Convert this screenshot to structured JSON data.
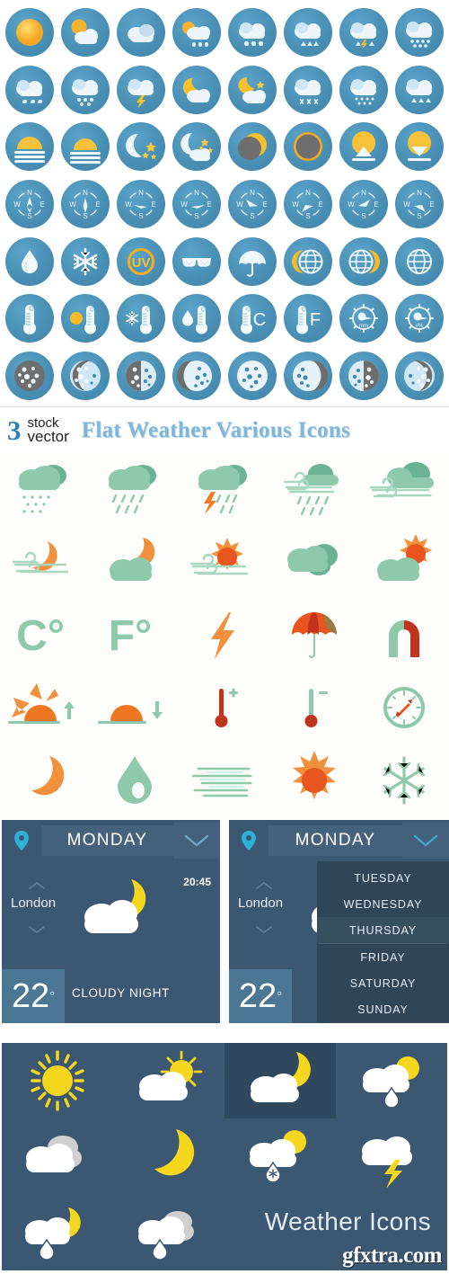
{
  "title_band": {
    "number": "3",
    "stock": "stock",
    "vector": "vector",
    "title": "Flat Weather Various Icons"
  },
  "icon_grid": {
    "style": "circular glossy blue badges",
    "circle_color": "#4a90b5",
    "rows": [
      [
        "sun-icon",
        "sun-behind-cloud-icon",
        "cloud-icon",
        "cloud-drizzle-sun-icon",
        "cloud-hail-icon",
        "cloud-sleet-icon",
        "cloud-thunder-rain-icon",
        "cloud-heavy-rain-icon"
      ],
      [
        "cloud-snow-icon",
        "cloud-snow-heavy-icon",
        "cloud-lightning-icon",
        "cloud-moon-icon",
        "cloud-moon-stars-icon",
        "cloud-snow-night-icon",
        "cloud-sleet-night-icon",
        "cloud-snow-blue-icon"
      ],
      [
        "sunrise-horizon-icon",
        "sunset-horizon-icon",
        "moon-stars-icon",
        "moon-stars-cloud-icon",
        "solar-eclipse-partial-icon",
        "solar-eclipse-full-icon",
        "sunrise-arrow-up-icon",
        "sunset-arrow-down-icon"
      ],
      [
        "compass-north-icon",
        "compass-needle-icon",
        "compass-east-icon",
        "compass-west-icon",
        "compass-ne-icon",
        "compass-se-icon",
        "compass-sw-icon",
        "compass-nw-icon"
      ],
      [
        "water-drop-icon",
        "snowflake-icon",
        "uv-index-icon",
        "sunglasses-icon",
        "umbrella-icon",
        "globe-moon-left-icon",
        "globe-moon-right-icon",
        "globe-icon"
      ],
      [
        "thermometer-icon",
        "thermometer-hot-icon",
        "thermometer-cold-icon",
        "thermometer-humidity-icon",
        "thermometer-celsius-icon",
        "thermometer-fahrenheit-icon",
        "rain-gauge-mm-icon",
        "humidity-gauge-percent-icon"
      ],
      [
        "moon-full-icon",
        "moon-waning-gibbous-icon",
        "moon-last-quarter-icon",
        "moon-waning-crescent-icon",
        "moon-new-icon",
        "moon-waxing-crescent-icon",
        "moon-first-quarter-icon",
        "moon-waxing-gibbous-icon"
      ]
    ],
    "labels": {
      "uv": "UV",
      "celsius": "C",
      "fahrenheit": "F",
      "gauge_mm": "mm",
      "gauge_pct": "#%",
      "compass_n": "N",
      "compass_e": "E",
      "compass_s": "S",
      "compass_w": "W"
    }
  },
  "flat_icons": {
    "palette": {
      "green": "#8fc9ab",
      "green_dark": "#6bb394",
      "orange": "#f2913d",
      "orange_dark": "#e8551f",
      "red": "#c0341d"
    },
    "rows": [
      [
        "cloud-drizzle-icon",
        "cloud-rain-icon",
        "cloud-thunderstorm-icon",
        "cloud-wind-rain-icon",
        "cloud-wind-icon"
      ],
      [
        "moon-wind-icon",
        "cloud-moon-icon",
        "sun-wind-icon",
        "clouds-icon",
        "cloud-sun-icon"
      ],
      [
        "celsius-icon",
        "fahrenheit-icon",
        "lightning-bolt-icon",
        "umbrella-icon",
        "magnet-icon"
      ],
      [
        "sunrise-icon",
        "sunset-icon",
        "thermometer-hot-icon",
        "thermometer-cold-icon",
        "compass-icon"
      ],
      [
        "moon-icon",
        "water-drop-icon",
        "fog-icon",
        "sun-icon",
        "snowflake-icon"
      ]
    ],
    "labels": {
      "celsius": "C°",
      "fahrenheit": "F°"
    }
  },
  "widgets": [
    {
      "name": "weather-widget-collapsed",
      "day": "MONDAY",
      "city": "London",
      "time": "20:45",
      "temperature": "22",
      "degree": "°",
      "condition": "CLOUDY NIGHT",
      "icon": "cloud-moon-icon",
      "dropdown_open": false
    },
    {
      "name": "weather-widget-expanded",
      "day": "MONDAY",
      "city": "London",
      "time": "",
      "temperature": "22",
      "degree": "°",
      "condition": "",
      "icon": "cloud-moon-icon",
      "dropdown_open": true,
      "dropdown_items": [
        {
          "label": "TUESDAY",
          "highlighted": false
        },
        {
          "label": "WEDNESDAY",
          "highlighted": false
        },
        {
          "label": "THURSDAY",
          "highlighted": true
        },
        {
          "label": "FRIDAY",
          "highlighted": false
        },
        {
          "label": "SATURDAY",
          "highlighted": false
        },
        {
          "label": "SUNDAY",
          "highlighted": false
        }
      ]
    }
  ],
  "dark_panel": {
    "background": "#3c5771",
    "label": "Weather Icons",
    "watermark": "gfxtra.com",
    "icons": [
      {
        "name": "sun-icon",
        "selected": false
      },
      {
        "name": "cloud-sun-icon",
        "selected": false
      },
      {
        "name": "cloud-moon-icon",
        "selected": true
      },
      {
        "name": "cloud-sun-rain-icon",
        "selected": false
      },
      {
        "name": "clouds-overcast-icon",
        "selected": false
      },
      {
        "name": "moon-icon",
        "selected": false
      },
      {
        "name": "cloud-sun-sleet-icon",
        "selected": false
      },
      {
        "name": "cloud-lightning-icon",
        "selected": false
      },
      {
        "name": "cloud-moon-rain-icon",
        "selected": false
      },
      {
        "name": "clouds-rain-icon",
        "selected": false
      },
      {
        "name": "panel-label",
        "selected": false
      },
      {
        "name": "watermark",
        "selected": false
      }
    ]
  }
}
